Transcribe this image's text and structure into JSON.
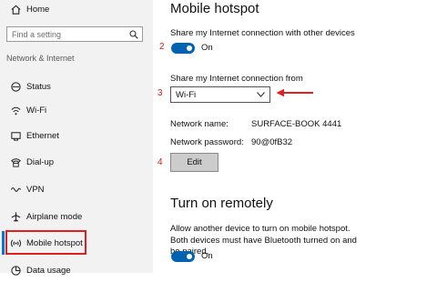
{
  "sidebar": {
    "home_label": "Home",
    "search_placeholder": "Find a setting",
    "section_label": "Network & Internet",
    "items": [
      {
        "label": "Status",
        "icon": "status-icon"
      },
      {
        "label": "Wi-Fi",
        "icon": "wifi-icon"
      },
      {
        "label": "Ethernet",
        "icon": "ethernet-icon"
      },
      {
        "label": "Dial-up",
        "icon": "dialup-icon"
      },
      {
        "label": "VPN",
        "icon": "vpn-icon"
      },
      {
        "label": "Airplane mode",
        "icon": "airplane-icon"
      },
      {
        "label": "Mobile hotspot",
        "icon": "hotspot-icon",
        "selected": true
      },
      {
        "label": "Data usage",
        "icon": "data-usage-icon"
      }
    ]
  },
  "main": {
    "title": "Mobile hotspot",
    "share_label": "Share my Internet connection with other devices",
    "share_toggle_state": "On",
    "share_from_label": "Share my Internet connection from",
    "share_from_value": "Wi-Fi",
    "network_name_label": "Network name:",
    "network_name_value": "SURFACE-BOOK 4441",
    "network_password_label": "Network password:",
    "network_password_value": "90@0fB32",
    "edit_button_label": "Edit",
    "remote_title": "Turn on remotely",
    "remote_desc": "Allow another device to turn on mobile hotspot. Both devices must have Bluetooth turned on and be paired.",
    "remote_toggle_state": "On"
  },
  "annotations": {
    "step2": "2",
    "step3": "3",
    "step4": "4",
    "color": "#e02020"
  },
  "colors": {
    "accent": "#0078d7",
    "toggle_on": "#0063b1"
  }
}
